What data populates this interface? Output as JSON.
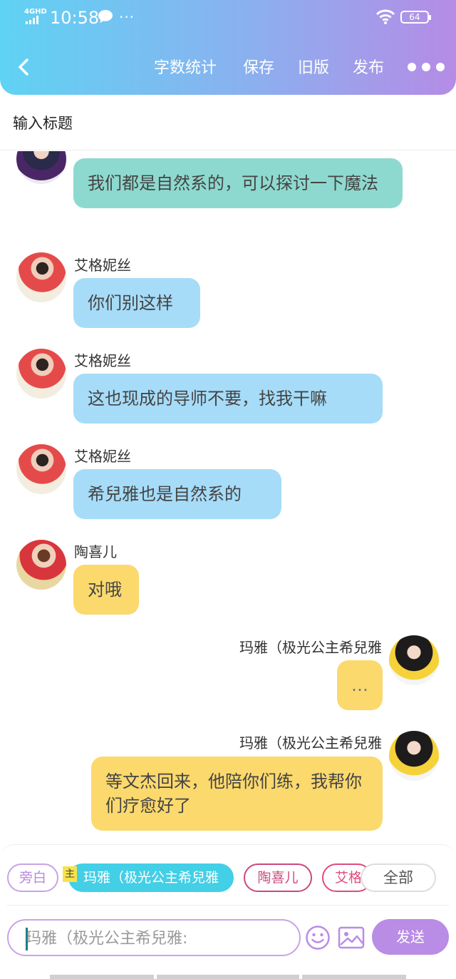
{
  "status_bar": {
    "network": "4GHD",
    "time": "10:58",
    "more_dots": "···",
    "battery": "64"
  },
  "toolbar": {
    "word_count": "字数统计",
    "save": "保存",
    "old_version": "旧版",
    "publish": "发布"
  },
  "title_input": {
    "placeholder": "输入标题"
  },
  "messages": [
    {
      "side": "left",
      "name": "",
      "text": "我们都是自然系的，可以探讨一下魔法",
      "color": "#8ed9cf"
    },
    {
      "side": "left",
      "name": "艾格妮丝",
      "text": "你们别这样",
      "color": "#a6dcf8"
    },
    {
      "side": "left",
      "name": "艾格妮丝",
      "text": "这也现成的导师不要，找我干嘛",
      "color": "#a6dcf8"
    },
    {
      "side": "left",
      "name": "艾格妮丝",
      "text": "希兒雅也是自然系的",
      "color": "#a6dcf8"
    },
    {
      "side": "left",
      "name": "陶喜儿",
      "text": "对哦",
      "color": "#fbd96d"
    },
    {
      "side": "right",
      "name": "玛雅（极光公主希兒雅",
      "text": "…",
      "color": "#fbd96d"
    },
    {
      "side": "right",
      "name": "玛雅（极光公主希兒雅",
      "text": "等文杰回来，他陪你们练，我帮你们疗愈好了",
      "color": "#fbd96d"
    }
  ],
  "role_chips": {
    "narration": "旁白",
    "main_badge": "主",
    "active": "玛雅（极光公主希兒雅",
    "tao": "陶喜儿",
    "ai": "艾格",
    "all": "全部"
  },
  "composer": {
    "placeholder": "玛雅（极光公主希兒雅:",
    "send": "发送"
  },
  "colors": {
    "header_gradient_start": "#5fd3f3",
    "header_gradient_end": "#b58ce6",
    "accent_purple": "#b98ce6",
    "active_chip": "#43cfe6"
  }
}
